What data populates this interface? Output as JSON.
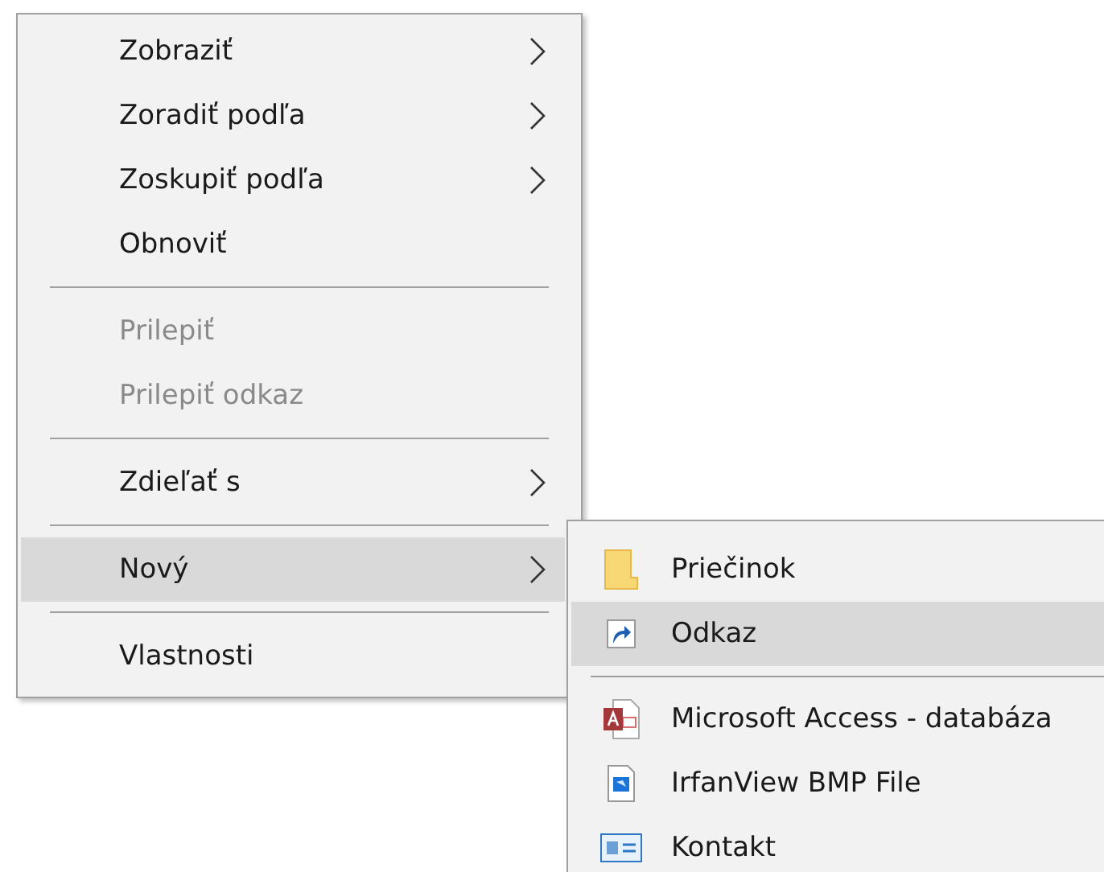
{
  "context_menu": {
    "groups": [
      [
        {
          "label": "Zobraziť",
          "has_submenu": true,
          "disabled": false,
          "selected": false
        },
        {
          "label": "Zoradiť podľa",
          "has_submenu": true,
          "disabled": false,
          "selected": false
        },
        {
          "label": "Zoskupiť podľa",
          "has_submenu": true,
          "disabled": false,
          "selected": false
        },
        {
          "label": "Obnoviť",
          "has_submenu": false,
          "disabled": false,
          "selected": false
        }
      ],
      [
        {
          "label": "Prilepiť",
          "has_submenu": false,
          "disabled": true,
          "selected": false
        },
        {
          "label": "Prilepiť odkaz",
          "has_submenu": false,
          "disabled": true,
          "selected": false
        }
      ],
      [
        {
          "label": "Zdieľať s",
          "has_submenu": true,
          "disabled": false,
          "selected": false
        }
      ],
      [
        {
          "label": "Nový",
          "has_submenu": true,
          "disabled": false,
          "selected": true
        }
      ],
      [
        {
          "label": "Vlastnosti",
          "has_submenu": false,
          "disabled": false,
          "selected": false
        }
      ]
    ]
  },
  "submenu": {
    "groups": [
      [
        {
          "label": "Priečinok",
          "selected": false
        },
        {
          "label": "Odkaz",
          "selected": true
        }
      ],
      [
        {
          "label": "Microsoft Access - databáza",
          "selected": false
        },
        {
          "label": "IrfanView BMP File",
          "selected": false
        },
        {
          "label": "Kontakt",
          "selected": false
        }
      ]
    ]
  }
}
